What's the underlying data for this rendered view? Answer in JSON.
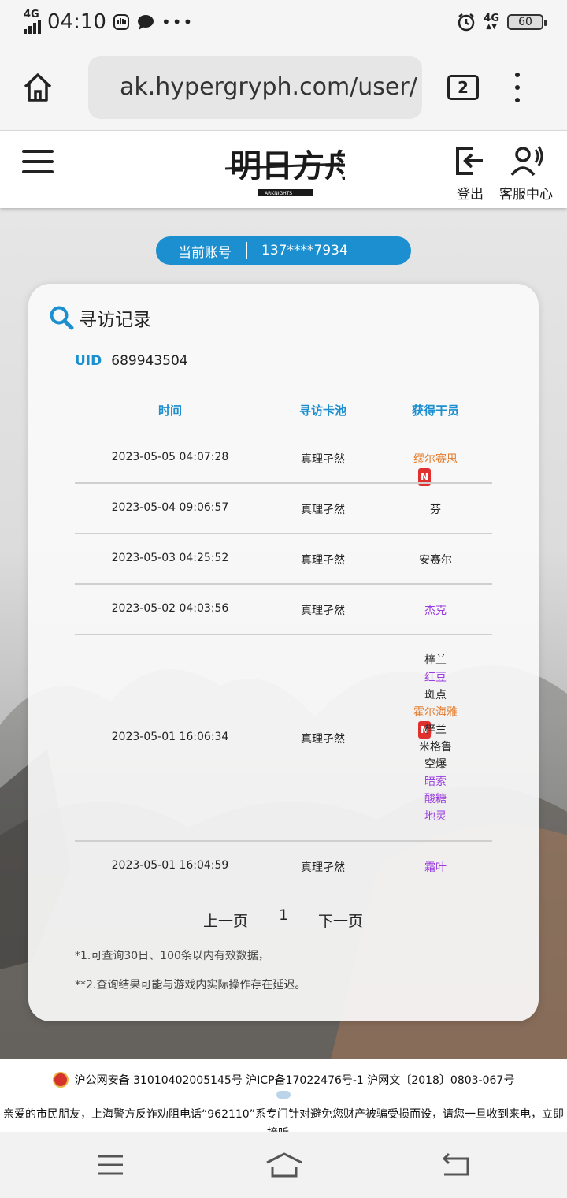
{
  "status_bar": {
    "network_left": "4G",
    "time": "04:10",
    "network_right": "4G",
    "battery": "60"
  },
  "browser": {
    "url": "ak.hypergryph.com/user/",
    "tab_count": "2"
  },
  "site_header": {
    "logout_label": "登出",
    "service_label": "客服中心"
  },
  "account": {
    "label": "当前账号",
    "value": "137****7934"
  },
  "records": {
    "title": "寻访记录",
    "uid_label": "UID",
    "uid_value": "689943504",
    "columns": [
      "时间",
      "寻访卡池",
      "获得干员"
    ],
    "rows": [
      {
        "time": "2023-05-05 04:07:28",
        "pool": "真理孑然",
        "operators": [
          {
            "name": "缪尔赛思",
            "new": true,
            "color": "#e57a2a"
          }
        ]
      },
      {
        "time": "2023-05-04 09:06:57",
        "pool": "真理孑然",
        "operators": [
          {
            "name": "芬",
            "new": false,
            "color": "#222222"
          }
        ]
      },
      {
        "time": "2023-05-03 04:25:52",
        "pool": "真理孑然",
        "operators": [
          {
            "name": "安赛尔",
            "new": false,
            "color": "#222222"
          }
        ]
      },
      {
        "time": "2023-05-02 04:03:56",
        "pool": "真理孑然",
        "operators": [
          {
            "name": "杰克",
            "new": false,
            "color": "#9a3ce0"
          }
        ]
      },
      {
        "time": "2023-05-01 16:06:34",
        "pool": "真理孑然",
        "operators": [
          {
            "name": "梓兰",
            "new": false,
            "color": "#222222"
          },
          {
            "name": "红豆",
            "new": false,
            "color": "#9a3ce0"
          },
          {
            "name": "斑点",
            "new": false,
            "color": "#222222"
          },
          {
            "name": "霍尔海雅",
            "new": true,
            "color": "#e57a2a"
          },
          {
            "name": "梓兰",
            "new": false,
            "color": "#222222"
          },
          {
            "name": "米格鲁",
            "new": false,
            "color": "#222222"
          },
          {
            "name": "空爆",
            "new": false,
            "color": "#222222"
          },
          {
            "name": "暗索",
            "new": false,
            "color": "#9a3ce0"
          },
          {
            "name": "酸糖",
            "new": false,
            "color": "#9a3ce0"
          },
          {
            "name": "地灵",
            "new": false,
            "color": "#9a3ce0"
          }
        ]
      },
      {
        "time": "2023-05-01 16:04:59",
        "pool": "真理孑然",
        "operators": [
          {
            "name": "霜叶",
            "new": false,
            "color": "#9a3ce0"
          }
        ]
      }
    ],
    "new_badge": "N",
    "pager": {
      "prev": "上一页",
      "page": "1",
      "next": "下一页"
    },
    "notes": [
      "*1.可查询30日、100条以内有效数据，",
      "**2.查询结果可能与游戏内实际操作存在延迟。"
    ]
  },
  "footer": {
    "registration": "沪公网安备 31010402005145号 沪ICP备17022476号-1 沪网文〔2018〕0803-067号",
    "notice": "亲爱的市民朋友，上海警方反诈劝阻电话“962110”系专门针对避免您财产被骗受损而设，请您一旦收到来电，立即接听。"
  }
}
